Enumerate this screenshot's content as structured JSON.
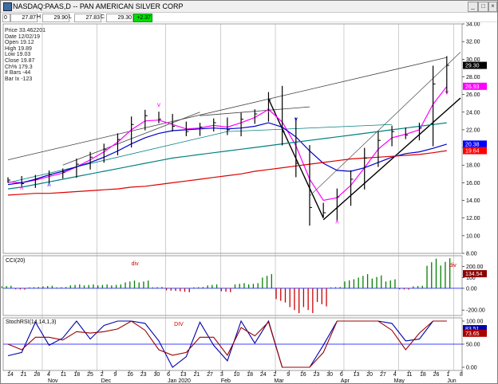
{
  "window": {
    "title": "NASDAQ:PAAS,D -- PAN AMERICAN SILVER CORP",
    "buttons": [
      "_",
      "□",
      "×"
    ]
  },
  "quote_bar": {
    "first": "0",
    "open": "27.87",
    "h_label": "H",
    "high": "29.90",
    "l_label": "L",
    "low": "27.83",
    "c_label": "C",
    "close": "29.30",
    "change": "+2.37"
  },
  "info_panel": {
    "lines": [
      "Price 33.462201",
      "Date 12/02/19",
      "Open 19.12",
      "High 19.89",
      "Low 19.03",
      "Close 19.87",
      "Ch% 179.3",
      "# Bars -44",
      "Bar Ix -123"
    ]
  },
  "price_axis": {
    "labels": [
      "34.00",
      "32.00",
      "30.00",
      "28.00",
      "26.00",
      "24.00",
      "22.00",
      "20.00",
      "18.00",
      "16.00",
      "14.00",
      "12.00",
      "10.00",
      "8.00"
    ],
    "values": [
      34,
      32,
      30,
      28,
      26,
      24,
      22,
      20,
      18,
      16,
      14,
      12,
      10,
      8
    ],
    "tags": [
      {
        "text": "29.30",
        "value": 29.3,
        "bg": "#000000",
        "fg": "#ffffff"
      },
      {
        "text": "26.93",
        "value": 26.93,
        "bg": "#ff00ff",
        "fg": "#ffffff"
      },
      {
        "text": "20.38",
        "value": 20.38,
        "bg": "#0000ff",
        "fg": "#ffffff"
      },
      {
        "text": "19.64",
        "value": 19.64,
        "bg": "#ff0000",
        "fg": "#ffffff"
      }
    ]
  },
  "cci_pane": {
    "title": "CCI(20)",
    "labels": [
      "200.00",
      "100",
      "0.00",
      "-200.00"
    ],
    "values": [
      200,
      100,
      0,
      -200
    ],
    "tag": {
      "text": "134.54",
      "value": 134.54,
      "bg": "#8b0000",
      "fg": "#ffffff"
    },
    "annotations": [
      {
        "text": "div",
        "color": "#cc0000"
      },
      {
        "text": "div",
        "color": "#cc0000"
      }
    ]
  },
  "stochrsi_pane": {
    "title": "StochRSI(14,14,1,3)",
    "labels": [
      "100.00",
      "50.00",
      "0.00"
    ],
    "values": [
      100,
      50,
      0
    ],
    "tags": [
      {
        "text": "83.51",
        "value": 83.51,
        "bg": "#0000aa",
        "fg": "#ffffff"
      },
      {
        "text": "73.65",
        "value": 73.65,
        "bg": "#aa0000",
        "fg": "#ffffff"
      }
    ],
    "annotations": [
      {
        "text": "DIV",
        "color": "#cc0000"
      }
    ]
  },
  "date_axis": {
    "ticks": [
      "14",
      "21",
      "28",
      "4",
      "11",
      "18",
      "25",
      "2",
      "9",
      "16",
      "23",
      "30",
      "6",
      "13",
      "21",
      "27",
      "3",
      "10",
      "18",
      "24",
      "2",
      "9",
      "16",
      "23",
      "30",
      "6",
      "13",
      "20",
      "27",
      "4",
      "11",
      "18",
      "26",
      "1",
      "8"
    ],
    "months": [
      "Nov",
      "Dec",
      "Jan 2020",
      "Feb",
      "Mar",
      "Apr",
      "May",
      "Jun"
    ]
  },
  "markers": {
    "a": "ʌ",
    "v": "v"
  },
  "colors": {
    "bar": "#000000",
    "ma_short": "#ff00ff",
    "ma_mid": "#0000cc",
    "ma_long": "#dd0000",
    "ma_teal": "#008080",
    "cci_pos": "#008000",
    "cci_neg": "#cc0000",
    "stoch_k": "#0000aa",
    "stoch_d": "#990000"
  },
  "chart_data": {
    "type": "line",
    "title": "NASDAQ:PAAS,D -- PAN AMERICAN SILVER CORP",
    "xlabel": "",
    "ylabel": "",
    "ylim": [
      8,
      34
    ],
    "x": [
      "10/14",
      "10/21",
      "10/28",
      "11/04",
      "11/11",
      "11/18",
      "11/25",
      "12/02",
      "12/09",
      "12/16",
      "12/23",
      "12/30",
      "01/06",
      "01/13",
      "01/21",
      "01/27",
      "02/03",
      "02/10",
      "02/18",
      "02/24",
      "03/02",
      "03/09",
      "03/16",
      "03/23",
      "03/30",
      "04/06",
      "04/13",
      "04/20",
      "04/27",
      "05/04",
      "05/11",
      "05/18",
      "05/26",
      "06/01"
    ],
    "series": [
      {
        "values": [
          16.3,
          15.9,
          16.4,
          16.9,
          17.2,
          18.1,
          18.9,
          19.8,
          20.9,
          22.6,
          23.6,
          23.2,
          22.4,
          21.8,
          22.3,
          22.8,
          22.0,
          23.2,
          23.8,
          25.4,
          21.8,
          18.2,
          13.2,
          12.6,
          14.4,
          16.4,
          18.8,
          20.8,
          21.8,
          21.4,
          22.2,
          27.2,
          29.3,
          null
        ]
      },
      {
        "values": [
          16.1,
          16.0,
          16.3,
          16.7,
          17.1,
          17.8,
          18.6,
          19.5,
          20.6,
          22.0,
          23.0,
          23.1,
          22.6,
          22.1,
          22.2,
          22.5,
          22.3,
          22.8,
          23.4,
          24.3,
          22.9,
          20.2,
          16.4,
          14.0,
          14.3,
          15.7,
          17.7,
          19.8,
          21.1,
          21.5,
          22.0,
          24.9,
          26.9,
          null
        ]
      },
      {
        "values": [
          15.8,
          16.0,
          16.4,
          16.9,
          17.3,
          17.8,
          18.3,
          18.9,
          19.6,
          20.4,
          21.1,
          21.6,
          21.9,
          22.0,
          22.1,
          22.2,
          22.1,
          22.2,
          22.4,
          22.8,
          22.3,
          21.2,
          19.6,
          18.2,
          17.4,
          17.3,
          17.7,
          18.3,
          18.9,
          19.3,
          19.5,
          19.9,
          20.38,
          null
        ]
      },
      {
        "values": [
          15.3,
          15.5,
          15.8,
          16.1,
          16.4,
          16.7,
          17.0,
          17.3,
          17.6,
          17.9,
          18.2,
          18.5,
          18.8,
          19.0,
          19.2,
          19.4,
          19.6,
          19.8,
          20.0,
          20.2,
          20.4,
          20.6,
          20.8,
          21.0,
          21.2,
          21.4,
          21.6,
          21.8,
          22.0,
          22.2,
          22.4,
          22.6,
          22.8,
          null
        ]
      },
      {
        "values": [
          14.6,
          14.7,
          14.8,
          14.8,
          14.9,
          15.0,
          15.1,
          15.2,
          15.3,
          15.5,
          15.6,
          15.8,
          16.0,
          16.2,
          16.4,
          16.6,
          16.8,
          17.0,
          17.3,
          17.5,
          17.7,
          17.9,
          18.1,
          18.3,
          18.5,
          18.7,
          18.8,
          18.9,
          19.0,
          19.1,
          19.2,
          19.4,
          19.64,
          null
        ]
      }
    ]
  }
}
